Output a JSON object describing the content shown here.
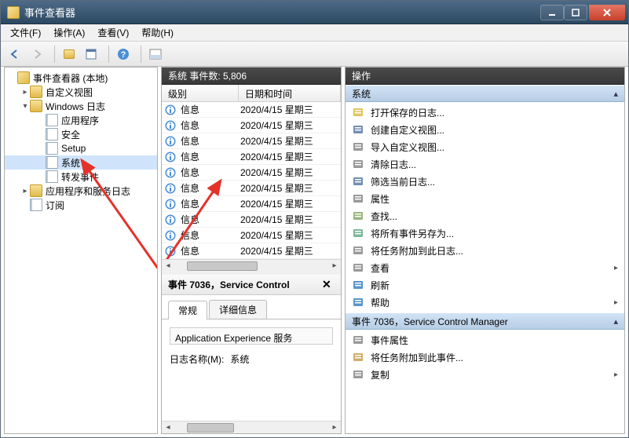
{
  "title": "事件查看器",
  "menus": [
    "文件(F)",
    "操作(A)",
    "查看(V)",
    "帮助(H)"
  ],
  "tree": {
    "root": "事件查看器 (本地)",
    "items": [
      {
        "label": "自定义视图",
        "icon": "folder",
        "level": 1,
        "exp": "▸"
      },
      {
        "label": "Windows 日志",
        "icon": "folder",
        "level": 1,
        "exp": "▾"
      },
      {
        "label": "应用程序",
        "icon": "log",
        "level": 2,
        "exp": ""
      },
      {
        "label": "安全",
        "icon": "log",
        "level": 2,
        "exp": ""
      },
      {
        "label": "Setup",
        "icon": "log",
        "level": 2,
        "exp": ""
      },
      {
        "label": "系统",
        "icon": "log",
        "level": 2,
        "exp": "",
        "selected": true
      },
      {
        "label": "转发事件",
        "icon": "log",
        "level": 2,
        "exp": ""
      },
      {
        "label": "应用程序和服务日志",
        "icon": "folder",
        "level": 1,
        "exp": "▸"
      },
      {
        "label": "订阅",
        "icon": "log",
        "level": 1,
        "exp": ""
      }
    ]
  },
  "middle": {
    "header": "系统    事件数: 5,806",
    "cols": [
      "级别",
      "日期和时间"
    ],
    "rows": [
      {
        "level": "信息",
        "date": "2020/4/15 星期三"
      },
      {
        "level": "信息",
        "date": "2020/4/15 星期三"
      },
      {
        "level": "信息",
        "date": "2020/4/15 星期三"
      },
      {
        "level": "信息",
        "date": "2020/4/15 星期三"
      },
      {
        "level": "信息",
        "date": "2020/4/15 星期三"
      },
      {
        "level": "信息",
        "date": "2020/4/15 星期三"
      },
      {
        "level": "信息",
        "date": "2020/4/15 星期三"
      },
      {
        "level": "信息",
        "date": "2020/4/15 星期三"
      },
      {
        "level": "信息",
        "date": "2020/4/15 星期三"
      },
      {
        "level": "信息",
        "date": "2020/4/15 星期三"
      }
    ]
  },
  "detail": {
    "header": "事件 7036，Service Control",
    "tabs": [
      "常规",
      "详细信息"
    ],
    "desc": "Application Experience 服务",
    "log_name_label": "日志名称(M):",
    "log_name_value": "系统"
  },
  "actions": {
    "title": "操作",
    "section1": "系统",
    "items1": [
      {
        "label": "打开保存的日志...",
        "icon": "open-log",
        "chev": false,
        "color": "#e0b94a"
      },
      {
        "label": "创建自定义视图...",
        "icon": "filter",
        "chev": false,
        "color": "#5b7ba5"
      },
      {
        "label": "导入自定义视图...",
        "icon": "import",
        "chev": false,
        "color": "#888"
      },
      {
        "label": "清除日志...",
        "icon": "clear",
        "chev": false,
        "color": "#888"
      },
      {
        "label": "筛选当前日志...",
        "icon": "filter2",
        "chev": false,
        "color": "#5b7ba5"
      },
      {
        "label": "属性",
        "icon": "props",
        "chev": false,
        "color": "#888"
      },
      {
        "label": "查找...",
        "icon": "find",
        "chev": false,
        "color": "#8a6"
      },
      {
        "label": "将所有事件另存为...",
        "icon": "saveas",
        "chev": false,
        "color": "#6a8"
      },
      {
        "label": "将任务附加到此日志...",
        "icon": "attach",
        "chev": false,
        "color": "#888"
      },
      {
        "label": "查看",
        "icon": "view",
        "chev": true,
        "color": "#888"
      },
      {
        "label": "刷新",
        "icon": "refresh",
        "chev": false,
        "color": "#3b82c4"
      },
      {
        "label": "帮助",
        "icon": "help",
        "chev": true,
        "color": "#3b82c4"
      }
    ],
    "section2": "事件 7036，Service Control Manager",
    "items2": [
      {
        "label": "事件属性",
        "icon": "evprops",
        "chev": false,
        "color": "#888"
      },
      {
        "label": "将任务附加到此事件...",
        "icon": "attach2",
        "chev": false,
        "color": "#c8a050"
      },
      {
        "label": "复制",
        "icon": "copy",
        "chev": true,
        "color": "#888"
      }
    ]
  }
}
